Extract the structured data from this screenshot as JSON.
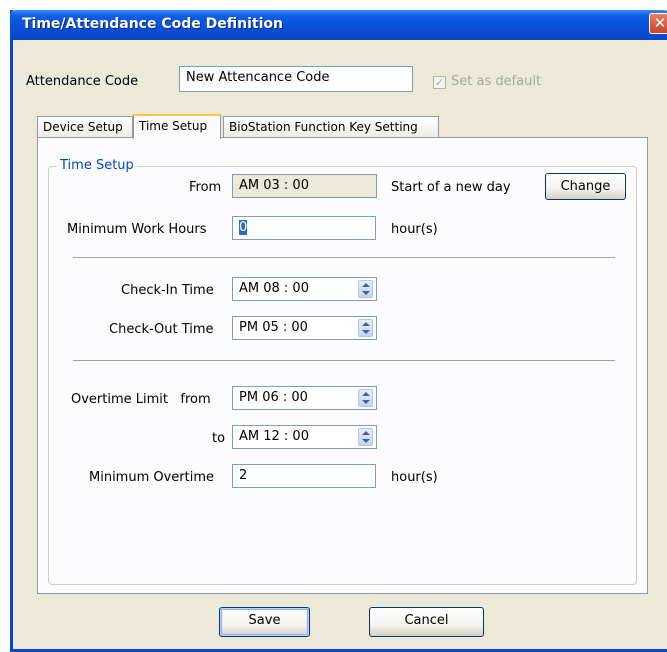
{
  "window": {
    "title": "Time/Attendance Code Definition",
    "close_glyph": "✕"
  },
  "header": {
    "attendance_code_label": "Attendance Code",
    "attendance_code_value": "New Attencance Code",
    "set_default_label": "Set as default",
    "set_default_checked": true,
    "set_default_enabled": false
  },
  "tabs": [
    {
      "label": "Device Setup",
      "active": false
    },
    {
      "label": "Time Setup",
      "active": true
    },
    {
      "label": "BioStation Function Key Setting",
      "active": false
    }
  ],
  "time_setup": {
    "group_title": "Time Setup",
    "from_label": "From",
    "from_value": "AM  03 : 00",
    "new_day_text": "Start of a new day",
    "change_button": "Change",
    "min_work_hours_label": "Minimum Work Hours",
    "min_work_hours_value": "0",
    "hours_unit_1": "hour(s)",
    "checkin_label": "Check-In Time",
    "checkin_value": "AM  08 : 00",
    "checkout_label": "Check-Out Time",
    "checkout_value": "PM  05 : 00",
    "overtime_from_label": "Overtime Limit   from",
    "overtime_from_value": "PM  06 : 00",
    "overtime_to_label": "to",
    "overtime_to_value": "AM  12 : 00",
    "min_overtime_label": "Minimum Overtime",
    "min_overtime_value": "2",
    "hours_unit_2": "hour(s)"
  },
  "footer": {
    "save_button": "Save",
    "cancel_button": "Cancel"
  },
  "colors": {
    "title_bar": "#0a4fd8",
    "group_title": "#0046d5",
    "window_bg": "#ece9d8",
    "active_tab_accent": "#ffc83c"
  },
  "icons": {
    "close": "close-icon",
    "spinner": "spinner-icon",
    "checkbox": "checkbox-checked-icon"
  }
}
